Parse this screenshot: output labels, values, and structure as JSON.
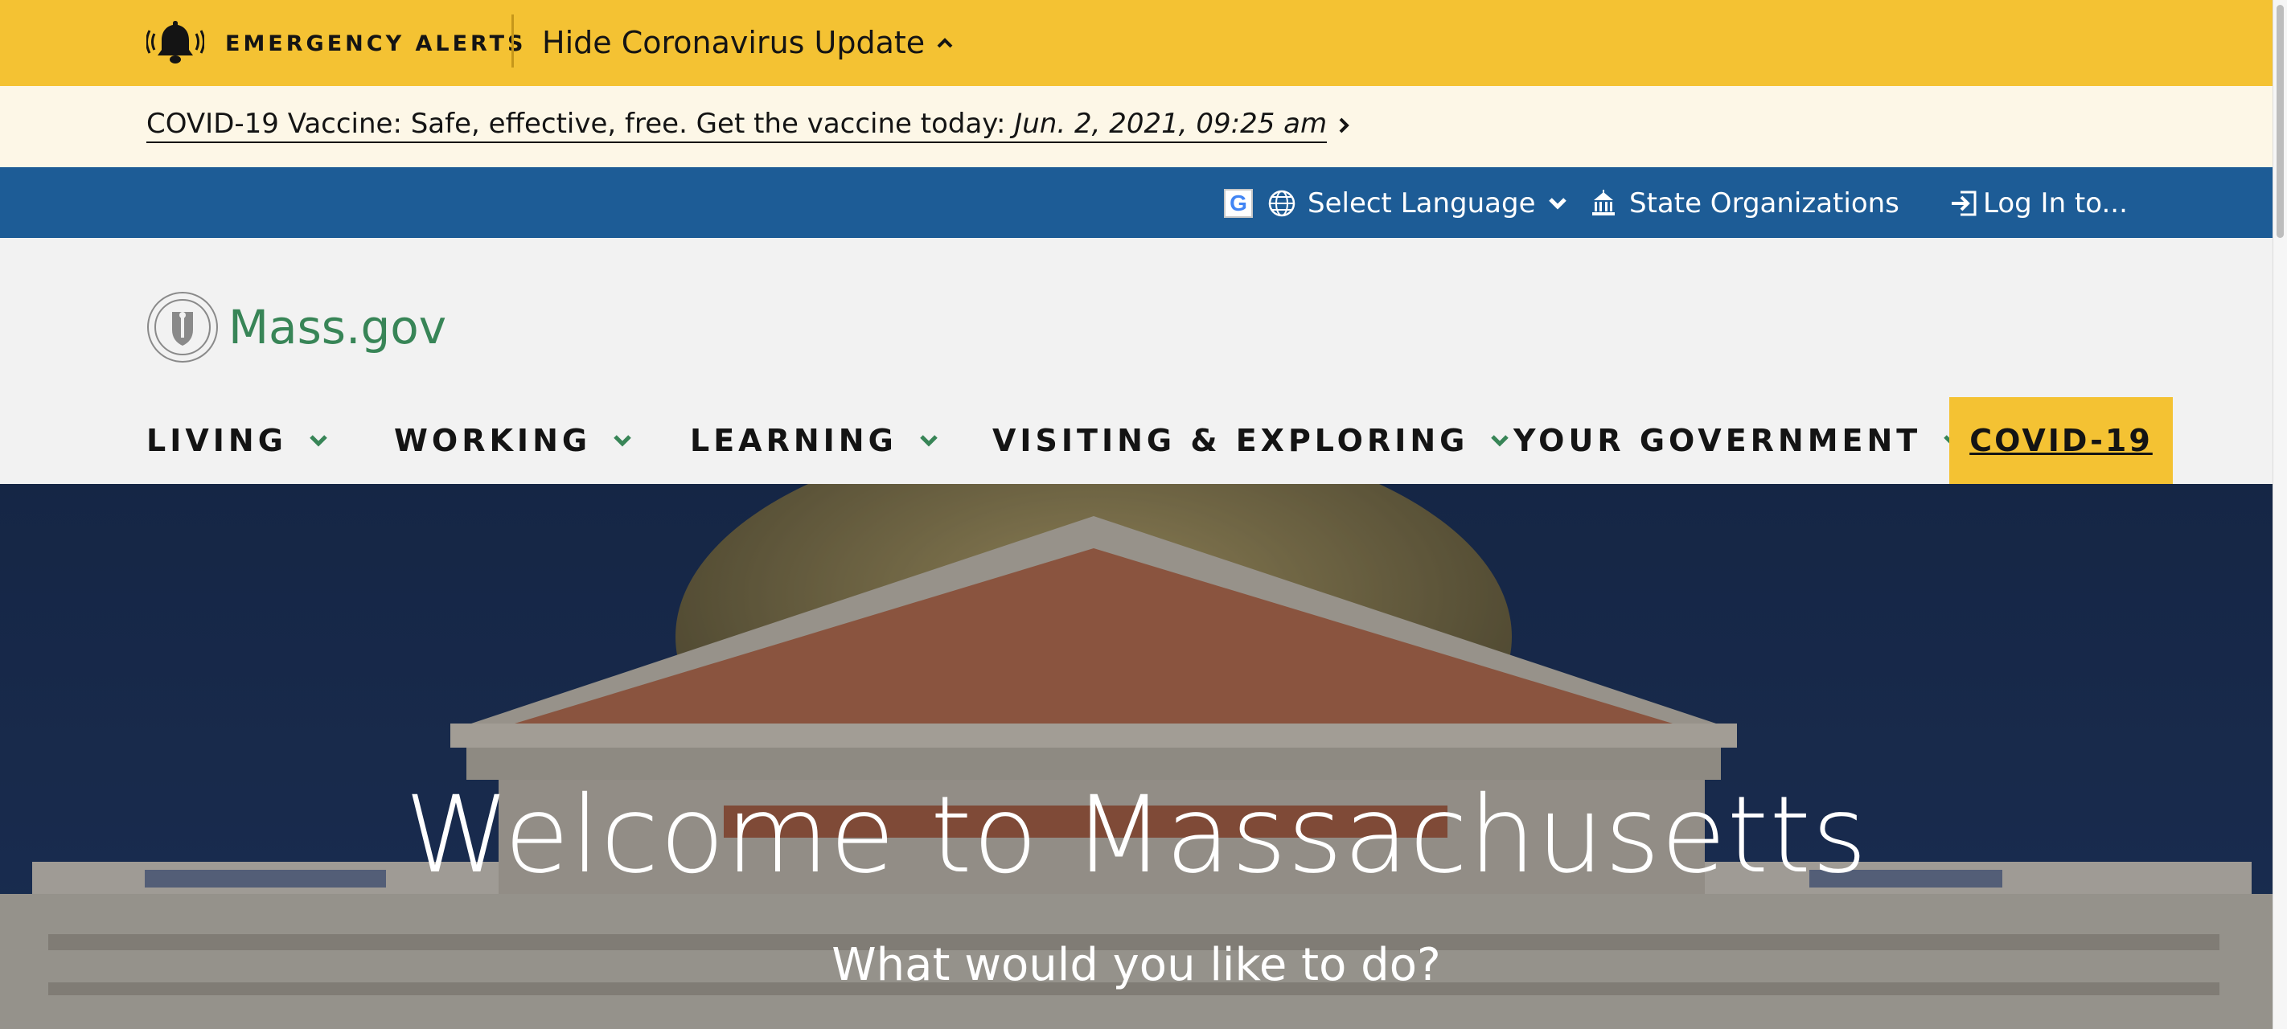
{
  "alert_bar": {
    "label": "EMERGENCY ALERTS",
    "toggle_label": "Hide Coronavirus Update",
    "bg_color": "#f4c233"
  },
  "vaccine_notice": {
    "text": "COVID-19 Vaccine: Safe, effective, free. Get the vaccine today: ",
    "date": "Jun. 2, 2021, 09:25 am"
  },
  "utility_nav": {
    "language_label": "Select Language",
    "google_badge": "G",
    "state_orgs_label": "State Organizations",
    "login_label": "Log In to...",
    "bg_color": "#1d5c96"
  },
  "header": {
    "logo_text": "Mass.gov",
    "logo_color": "#388557"
  },
  "main_nav": {
    "items": [
      {
        "label": "LIVING"
      },
      {
        "label": "WORKING"
      },
      {
        "label": "LEARNING"
      },
      {
        "label": "VISITING & EXPLORING"
      },
      {
        "label": "YOUR GOVERNMENT"
      }
    ],
    "covid_label": "COVID-19"
  },
  "hero": {
    "title": "Welcome to Massachusetts",
    "subtitle": "What would you like to do?"
  }
}
